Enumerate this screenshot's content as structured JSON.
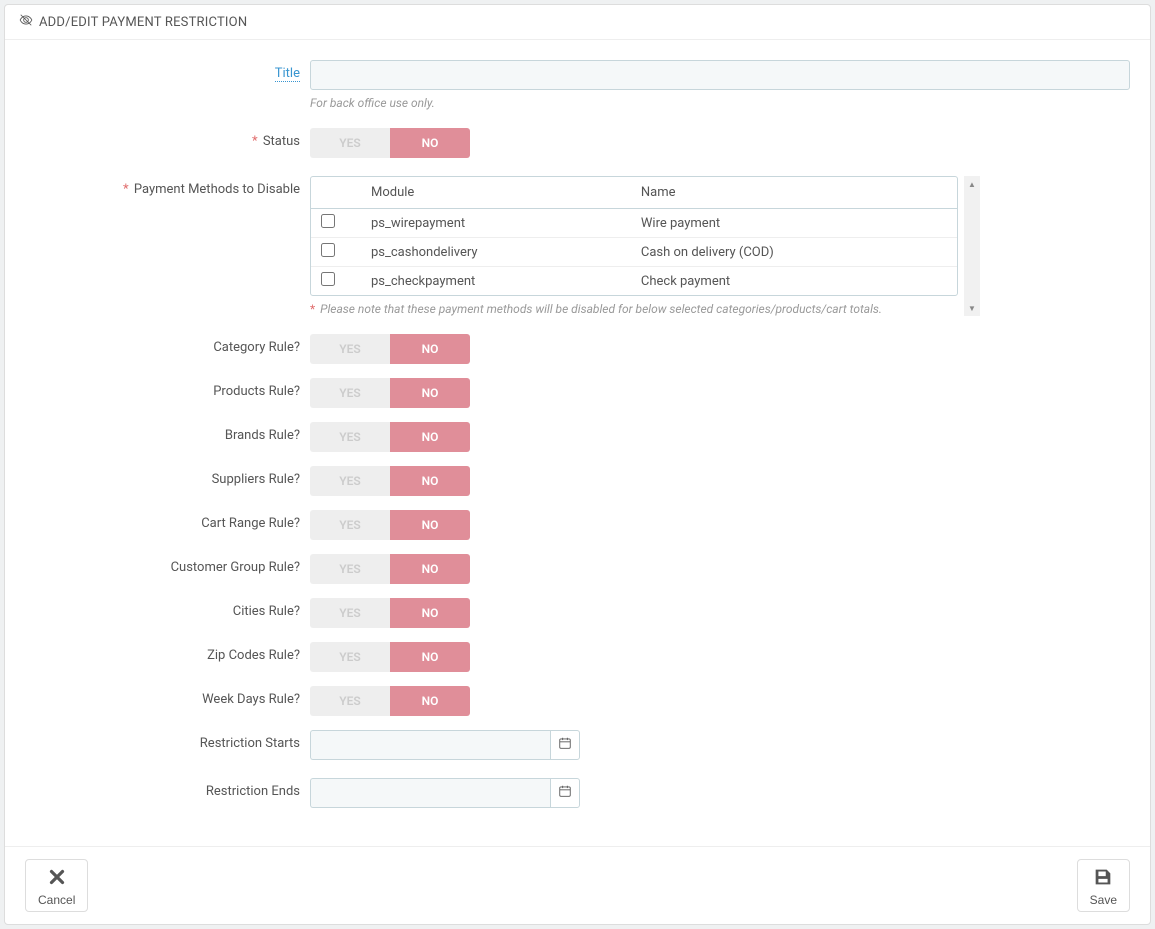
{
  "panel": {
    "title": "ADD/EDIT PAYMENT RESTRICTION"
  },
  "labels": {
    "title": "Title",
    "title_help": "For back office use only.",
    "status": "Status",
    "payment_methods": "Payment Methods to Disable",
    "payment_methods_help": "Please note that these payment methods will be disabled for below selected categories/products/cart totals.",
    "category_rule": "Category Rule?",
    "products_rule": "Products Rule?",
    "brands_rule": "Brands Rule?",
    "suppliers_rule": "Suppliers Rule?",
    "cart_range_rule": "Cart Range Rule?",
    "customer_group_rule": "Customer Group Rule?",
    "cities_rule": "Cities Rule?",
    "zip_codes_rule": "Zip Codes Rule?",
    "week_days_rule": "Week Days Rule?",
    "restriction_starts": "Restriction Starts",
    "restriction_ends": "Restriction Ends"
  },
  "toggle": {
    "yes": "YES",
    "no": "NO"
  },
  "table": {
    "headers": {
      "module": "Module",
      "name": "Name"
    },
    "rows": [
      {
        "module": "ps_wirepayment",
        "name": "Wire payment"
      },
      {
        "module": "ps_cashondelivery",
        "name": "Cash on delivery (COD)"
      },
      {
        "module": "ps_checkpayment",
        "name": "Check payment"
      }
    ]
  },
  "footer": {
    "cancel": "Cancel",
    "save": "Save"
  }
}
